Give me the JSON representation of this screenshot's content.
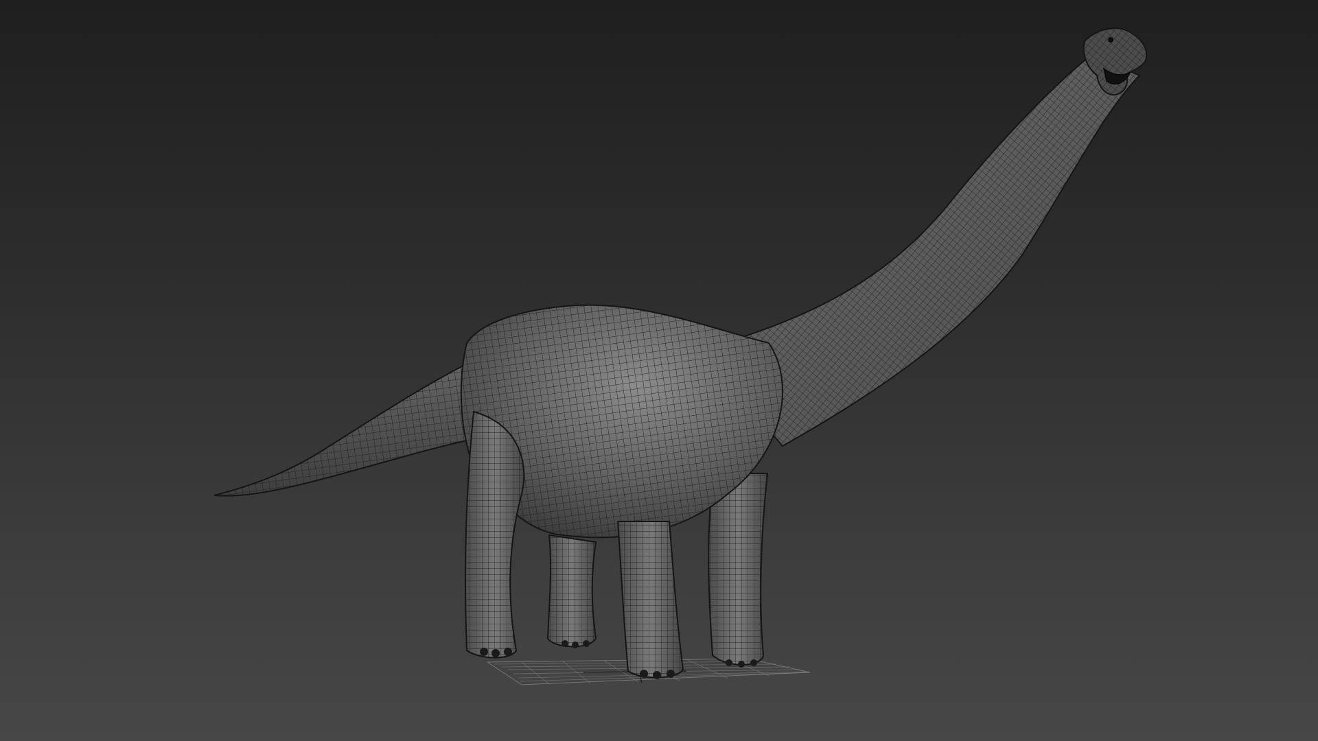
{
  "viewport": {
    "background_top": "#1f1f1f",
    "background_bottom": "#474747",
    "display_mode": "wireframe-on-shaded"
  },
  "model": {
    "subject": "sauropod-dinosaur-icon",
    "surface_color": "#5a5a5a",
    "wire_color": "#1b1b1b"
  },
  "ground_grid": {
    "line_color": "#8a8a8a"
  }
}
